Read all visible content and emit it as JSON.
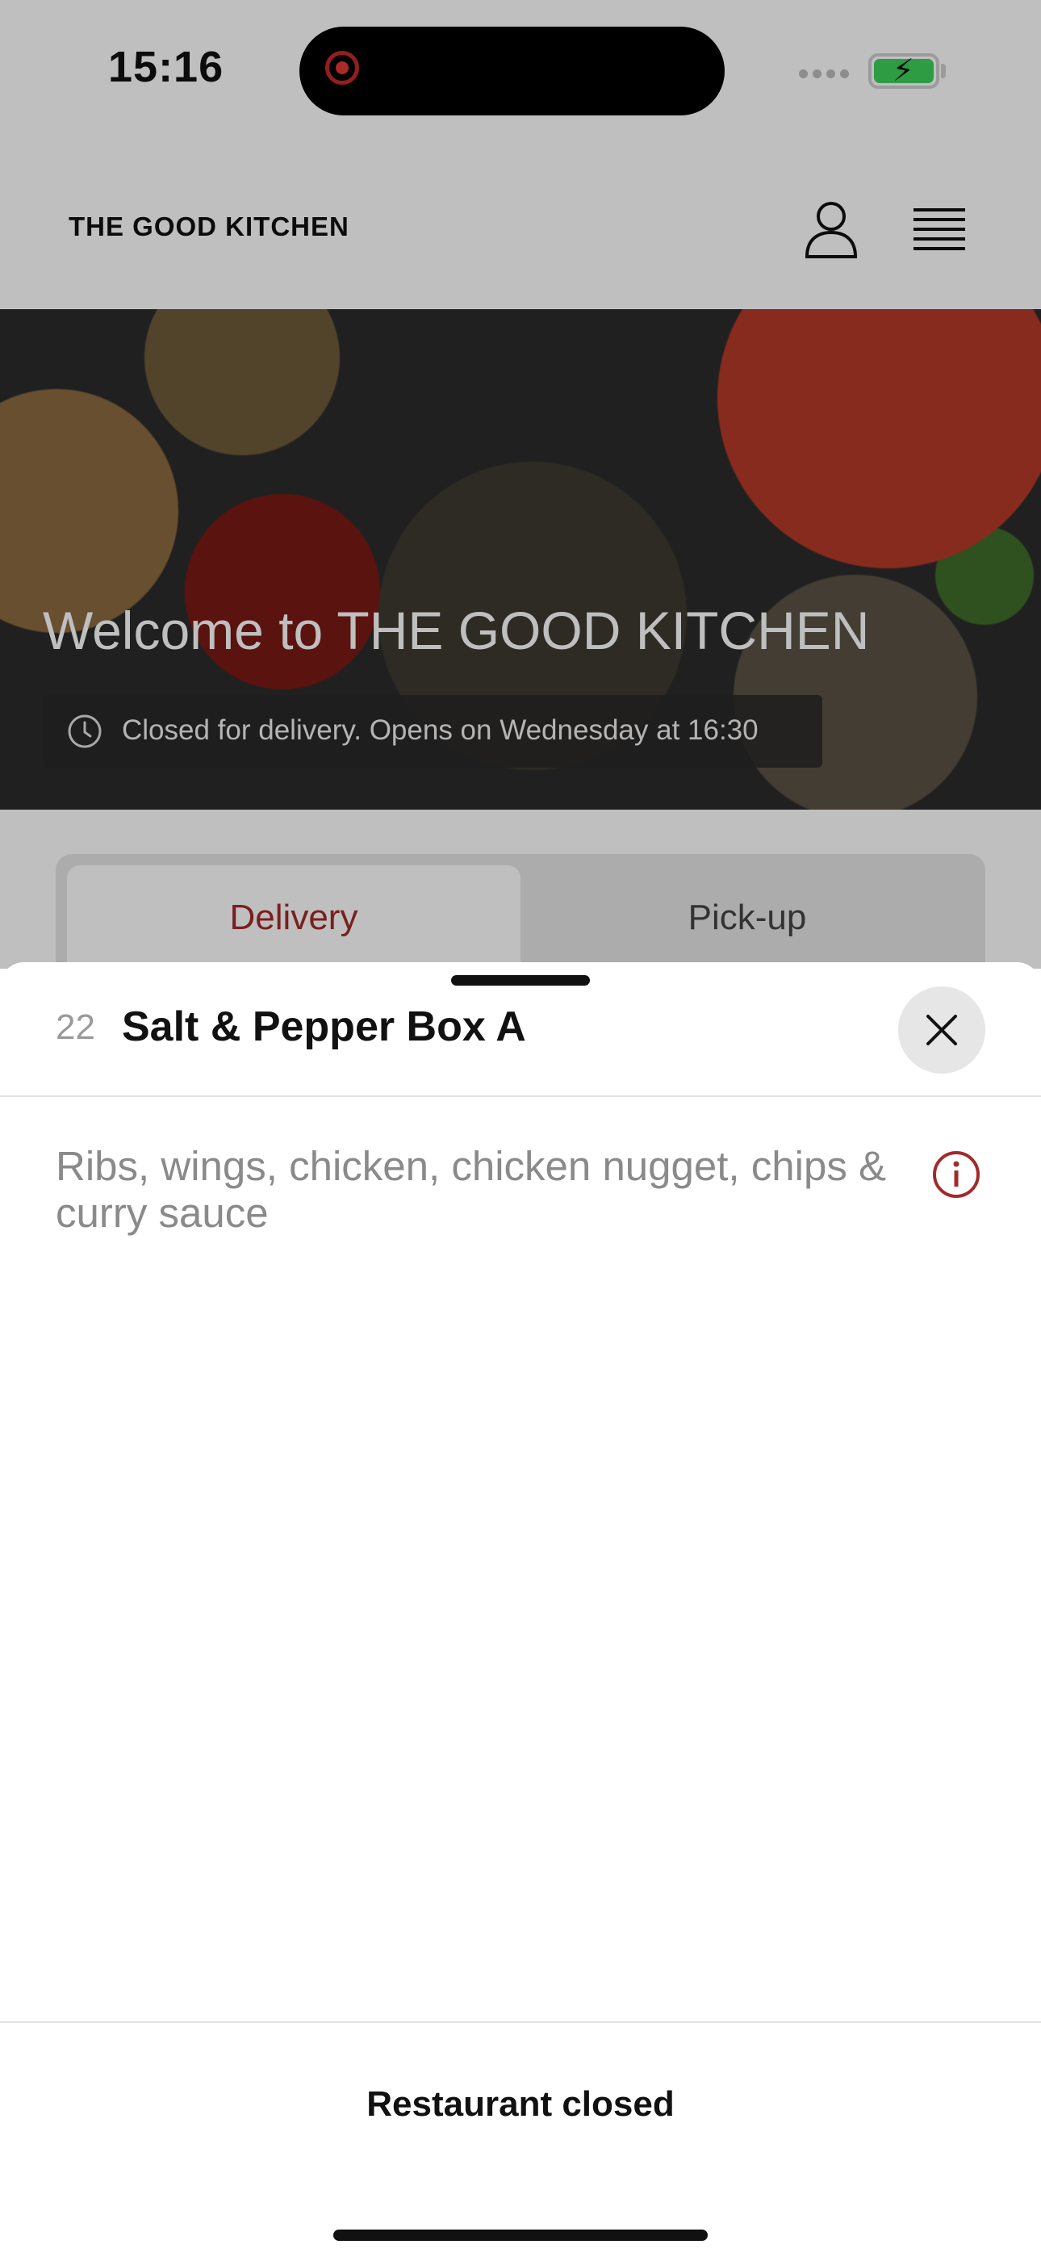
{
  "status_bar": {
    "time": "15:16",
    "recording_icon": "record-dot-icon",
    "signal_icon": "signal-icon",
    "battery_icon": "battery-charging-icon",
    "battery_color": "#3dd15a"
  },
  "header": {
    "brand": "THE GOOD KITCHEN",
    "account_icon": "user-icon",
    "menu_icon": "hamburger-menu-icon"
  },
  "hero": {
    "title": "Welcome to THE GOOD KITCHEN",
    "status_text": "Closed for delivery. Opens on Wednesday at 16:30",
    "status_icon": "clock-icon"
  },
  "order_tabs": [
    {
      "label": "Delivery",
      "active": true
    },
    {
      "label": "Pick-up",
      "active": false
    }
  ],
  "item_sheet": {
    "number": "22",
    "title": "Salt & Pepper Box A",
    "description": "Ribs, wings, chicken, chicken nugget, chips & curry sauce",
    "close_icon": "close-icon",
    "info_icon": "info-icon",
    "footer_label": "Restaurant closed"
  },
  "colors": {
    "accent": "#a32a2a",
    "sheet_background": "#ffffff",
    "muted_text": "#8a8a8a"
  }
}
